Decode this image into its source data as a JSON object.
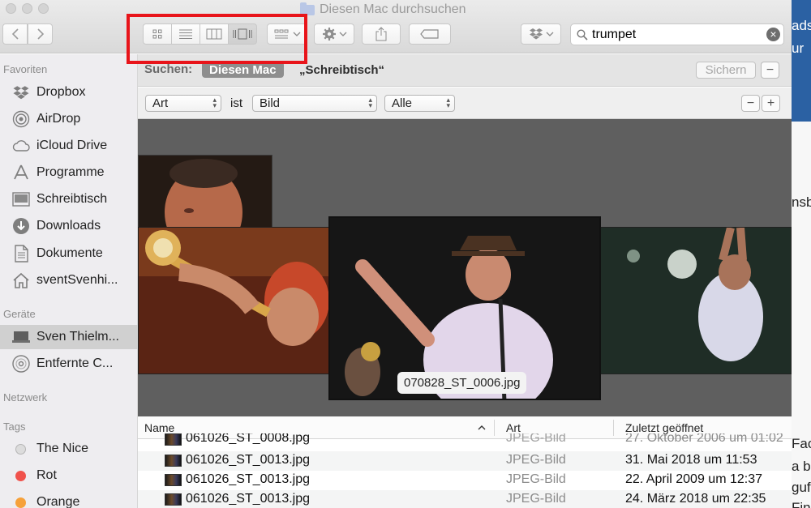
{
  "window": {
    "title": "Diesen Mac durchsuchen"
  },
  "toolbar": {
    "search_value": "trumpet"
  },
  "sidebar": {
    "sections": [
      {
        "heading": "Favoriten",
        "items": [
          "Dropbox",
          "AirDrop",
          "iCloud Drive",
          "Programme",
          "Schreibtisch",
          "Downloads",
          "Dokumente",
          "sventSvenhi..."
        ]
      },
      {
        "heading": "Geräte",
        "items": [
          "Sven Thielm...",
          "Entfernte C..."
        ]
      },
      {
        "heading": "Netzwerk",
        "items": []
      },
      {
        "heading": "Tags",
        "items": [
          "The Nice",
          "Rot",
          "Orange"
        ]
      }
    ],
    "tag_colors": {
      "the_nice": "#dcdcdc",
      "rot": "#f0524c",
      "orange": "#f6a13a"
    }
  },
  "scope": {
    "label": "Suchen:",
    "this_mac": "Diesen Mac",
    "desktop": "„Schreibtisch“",
    "save": "Sichern"
  },
  "criteria": {
    "attribute": "Art",
    "operator": "ist",
    "value": "Bild",
    "subvalue": "Alle"
  },
  "coverflow": {
    "caption": "070828_ST_0006.jpg"
  },
  "list": {
    "columns": {
      "name": "Name",
      "kind": "Art",
      "date": "Zuletzt geöffnet"
    },
    "rows": [
      {
        "name": "061026_ST_0008.jpg",
        "kind": "JPEG-Bild",
        "date": "27. Oktober 2006 um 01:02"
      },
      {
        "name": "061026_ST_0013.jpg",
        "kind": "JPEG-Bild",
        "date": "31. Mai 2018 um 11:53"
      },
      {
        "name": "061026_ST_0013.jpg",
        "kind": "JPEG-Bild",
        "date": "22. April 2009 um 12:37"
      },
      {
        "name": "061026_ST_0013.jpg",
        "kind": "JPEG-Bild",
        "date": "24. März 2018 um 22:35"
      }
    ]
  },
  "background_window": {
    "lines": [
      "ads",
      "ur",
      "nsb",
      "Fac",
      "a b",
      "guf",
      "Fin"
    ]
  },
  "colors": {
    "highlight_box": "#e8141a",
    "selected_row": "#d0d0d0"
  }
}
